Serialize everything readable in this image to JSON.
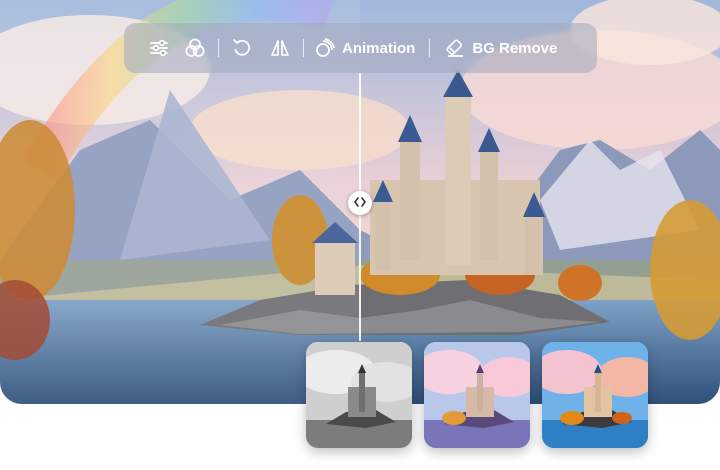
{
  "toolbar": {
    "items": [
      {
        "icon": "adjust-sliders-icon"
      },
      {
        "icon": "color-circles-icon"
      },
      {
        "icon": "rotate-icon"
      },
      {
        "icon": "flip-icon"
      },
      {
        "icon": "animation-icon",
        "label": "Animation"
      },
      {
        "icon": "eraser-icon",
        "label": "BG Remove"
      }
    ]
  },
  "split": {
    "handle_icon": "code-arrows-icon"
  },
  "thumbnails": [
    {
      "style": "grayscale"
    },
    {
      "style": "pastel"
    },
    {
      "style": "vivid"
    }
  ],
  "colors": {
    "sky_top": "#b7c9e6",
    "sky_pink": "#f2c9d4",
    "cloud": "#f8e7d6",
    "mountain": "#8d99b8",
    "lake": "#4f77a3",
    "castle": "#d9c7b3",
    "roof": "#3a5a90",
    "foliage": "#d68a24"
  }
}
